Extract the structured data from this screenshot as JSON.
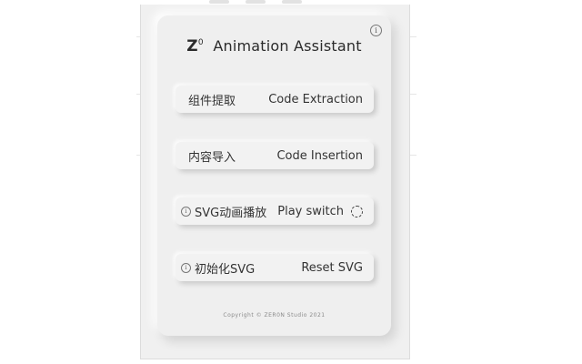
{
  "header": {
    "logo_letter": "Z",
    "logo_sup": "0",
    "title": "Animation Assistant"
  },
  "buttons": {
    "extract": {
      "label_cn": "组件提取",
      "label_en": "Code Extraction"
    },
    "insert": {
      "label_cn": "内容导入",
      "label_en": "Code Insertion"
    },
    "play": {
      "label_cn": "SVG动画播放",
      "label_en": "Play switch"
    },
    "reset": {
      "label_cn": "初始化SVG",
      "label_en": "Reset SVG"
    }
  },
  "footer": {
    "copyright": "Copyright © ZER0N Studio 2021"
  },
  "icons": {
    "info": "info-icon",
    "spinner": "loading-spinner-icon"
  },
  "colors": {
    "card_bg": "#efefef",
    "text": "#333333"
  }
}
